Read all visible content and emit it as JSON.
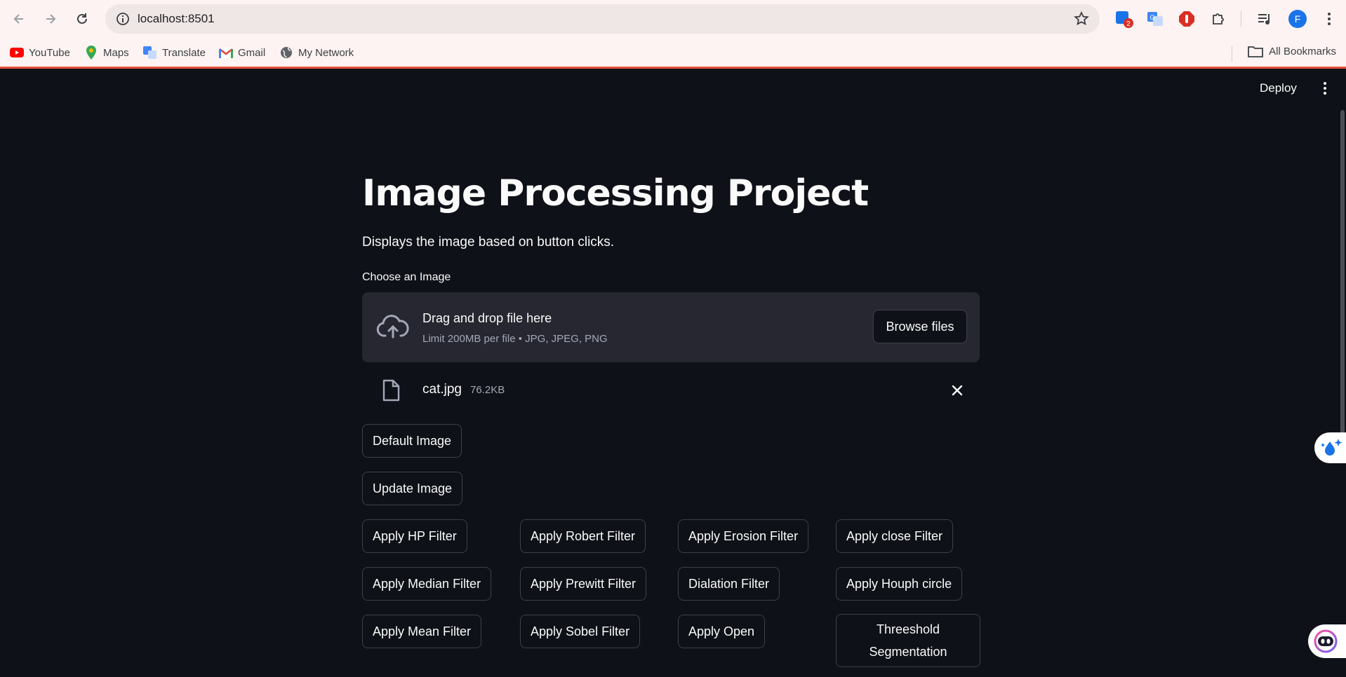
{
  "browser": {
    "url": "localhost:8501",
    "profile_initial": "F",
    "ext_badge": "2",
    "bookmarks": [
      {
        "label": "YouTube",
        "icon": "youtube-icon"
      },
      {
        "label": "Maps",
        "icon": "maps-icon"
      },
      {
        "label": "Translate",
        "icon": "translate-icon"
      },
      {
        "label": "Gmail",
        "icon": "gmail-icon"
      },
      {
        "label": "My Network",
        "icon": "globe-icon"
      }
    ],
    "all_bookmarks": "All Bookmarks"
  },
  "app": {
    "deploy_label": "Deploy",
    "title": "Image Processing Project",
    "subtitle": "Displays the image based on button clicks.",
    "uploader": {
      "label": "Choose an Image",
      "drop_text": "Drag and drop file here",
      "limit_text": "Limit 200MB per file • JPG, JPEG, PNG",
      "browse_label": "Browse files"
    },
    "file": {
      "name": "cat.jpg",
      "size": "76.2KB"
    },
    "buttons": {
      "default_image": "Default Image",
      "update_image": "Update Image",
      "hp_filter": "Apply HP Filter",
      "robert_filter": "Apply Robert Filter",
      "erosion_filter": "Apply Erosion Filter",
      "close_filter": "Apply close Filter",
      "median_filter": "Apply Median Filter",
      "prewitt_filter": "Apply Prewitt Filter",
      "dialation_filter": "Dialation Filter",
      "houph_circle": "Apply Houph circle",
      "mean_filter": "Apply Mean Filter",
      "sobel_filter": "Apply Sobel Filter",
      "open": "Apply Open",
      "threshold_segmentation": "Threeshold Segmentation"
    }
  },
  "colors": {
    "app_bg": "#0e1117",
    "surface": "#262730",
    "text": "#fafafa",
    "muted_text": "#a3a8b8",
    "chrome_bg": "#fdf3f2",
    "accent_strip": "#e4513a"
  }
}
